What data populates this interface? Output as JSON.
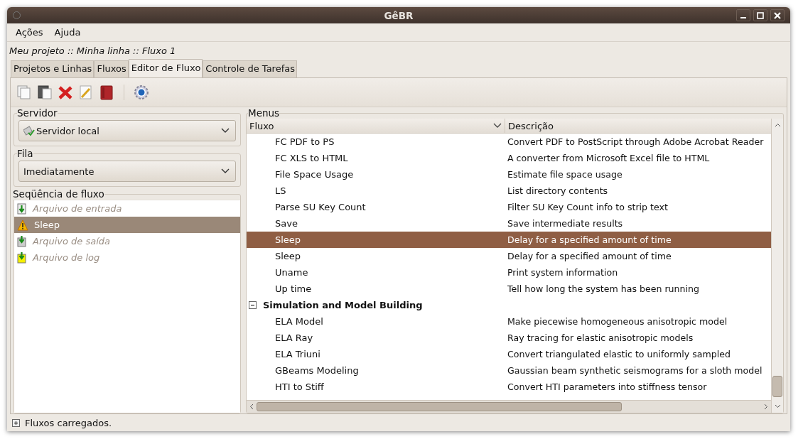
{
  "window": {
    "title": "GêBR"
  },
  "menu": [
    {
      "label": "Ações"
    },
    {
      "label": "Ajuda"
    }
  ],
  "breadcrumb": "Meu projeto :: Minha linha :: Fluxo 1",
  "tabs": [
    {
      "label": "Projetos e Linhas",
      "selected": false
    },
    {
      "label": "Fluxos",
      "selected": false
    },
    {
      "label": "Editor de Fluxo",
      "selected": true
    },
    {
      "label": "Controle de Tarefas",
      "selected": false
    }
  ],
  "server": {
    "label": "Servidor",
    "value": "Servidor local"
  },
  "queue": {
    "label": "Fila",
    "value": "Imediatamente"
  },
  "sequence": {
    "label": "Seqüência de fluxo",
    "items": [
      {
        "kind": "input",
        "label": "Arquivo de entrada",
        "disabled": true,
        "selected": false
      },
      {
        "kind": "warning",
        "label": "Sleep",
        "disabled": false,
        "selected": true
      },
      {
        "kind": "output",
        "label": "Arquivo de saída",
        "disabled": true,
        "selected": false
      },
      {
        "kind": "log",
        "label": "Arquivo de log",
        "disabled": true,
        "selected": false
      }
    ]
  },
  "menus": {
    "label": "Menus",
    "columns": [
      "Fluxo",
      "Descrição"
    ],
    "rows": [
      {
        "kind": "item",
        "name": "FC PDF to PS",
        "description": "Convert PDF to PostScript through Adobe Acrobat Reader",
        "selected": false
      },
      {
        "kind": "item",
        "name": "FC XLS to HTML",
        "description": "A converter from Microsoft Excel file to HTML",
        "selected": false
      },
      {
        "kind": "item",
        "name": "File Space Usage",
        "description": "Estimate file space usage",
        "selected": false
      },
      {
        "kind": "item",
        "name": "LS",
        "description": "List directory contents",
        "selected": false
      },
      {
        "kind": "item",
        "name": "Parse SU Key Count",
        "description": "Filter SU Key Count info to strip text",
        "selected": false
      },
      {
        "kind": "item",
        "name": "Save",
        "description": "Save intermediate results",
        "selected": false
      },
      {
        "kind": "item",
        "name": "Sleep",
        "description": "Delay for a specified amount of time",
        "selected": true
      },
      {
        "kind": "item",
        "name": "Sleep",
        "description": "Delay for a specified amount of time",
        "selected": false
      },
      {
        "kind": "item",
        "name": "Uname",
        "description": "Print system information",
        "selected": false
      },
      {
        "kind": "item",
        "name": "Up time",
        "description": "Tell how long the system has been running",
        "selected": false
      },
      {
        "kind": "category",
        "name": "Simulation and Model Building",
        "expanded": true,
        "selected": false
      },
      {
        "kind": "item",
        "name": "ELA Model",
        "description": "Make piecewise homogeneous anisotropic model",
        "selected": false
      },
      {
        "kind": "item",
        "name": "ELA Ray",
        "description": "Ray tracing for elastic anisotropic models",
        "selected": false
      },
      {
        "kind": "item",
        "name": "ELA Triuni",
        "description": "Convert triangulated elastic to uniformly sampled",
        "selected": false
      },
      {
        "kind": "item",
        "name": "GBeams Modeling",
        "description": "Gaussian beam synthetic seismograms for a sloth model",
        "selected": false
      },
      {
        "kind": "item",
        "name": "HTI to Stiff",
        "description": "Convert HTI parameters into stiffness tensor",
        "selected": false
      }
    ]
  },
  "status_bar": {
    "text": "Fluxos carregados.",
    "expanded": false
  }
}
